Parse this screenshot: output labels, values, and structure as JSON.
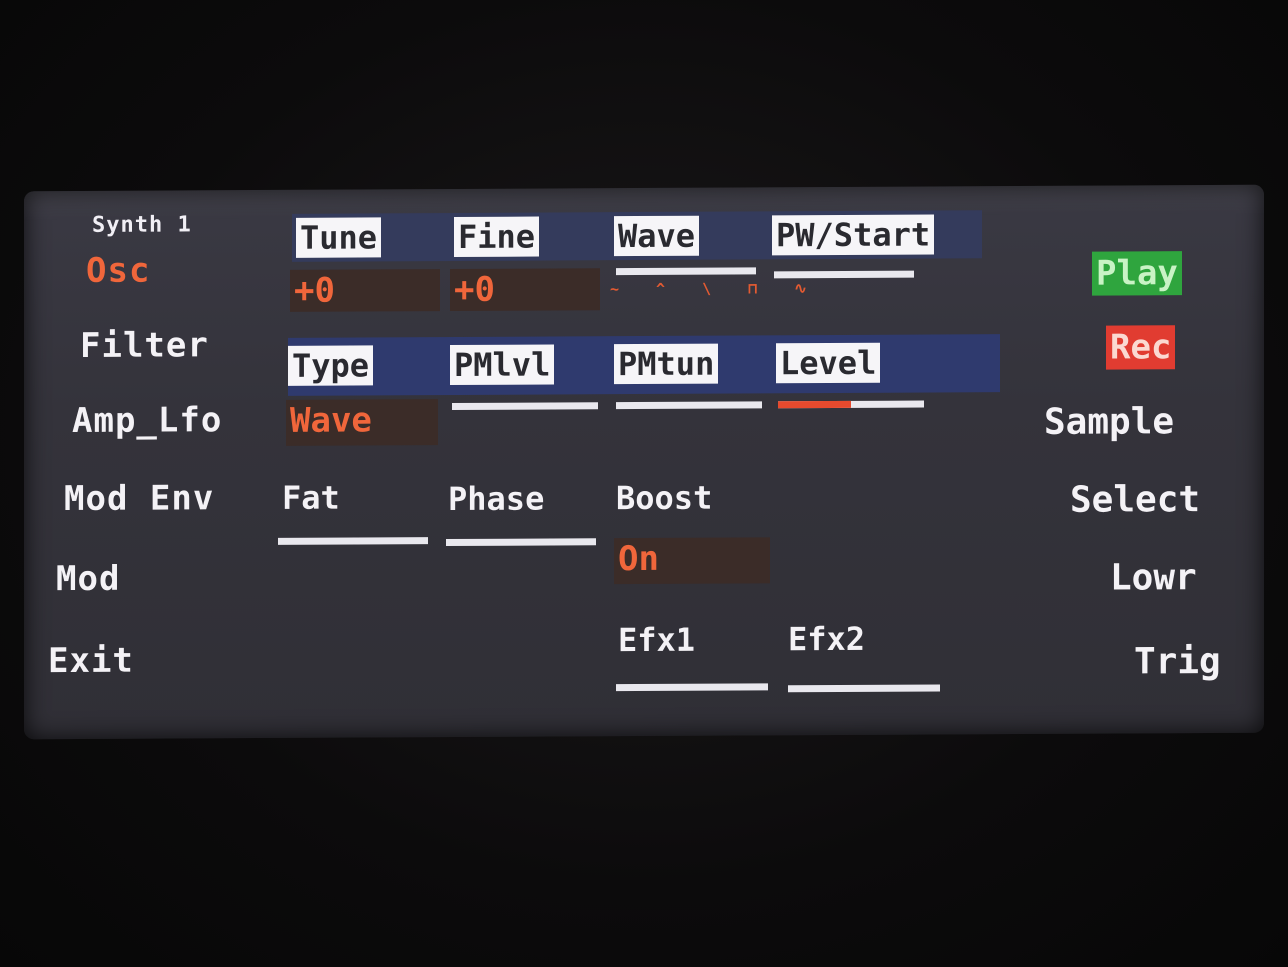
{
  "screen": {
    "title": "Synth 1"
  },
  "menu": {
    "items": [
      {
        "label": "Osc",
        "active": true
      },
      {
        "label": "Filter"
      },
      {
        "label": "Amp_Lfo"
      },
      {
        "label": "Mod Env"
      },
      {
        "label": "Mod"
      },
      {
        "label": "Exit"
      }
    ]
  },
  "row1": {
    "tune": {
      "label": "Tune",
      "value": "+0"
    },
    "fine": {
      "label": "Fine",
      "value": "+0"
    },
    "wave": {
      "label": "Wave",
      "icons": "~ ^ \\ ⊓ ∿"
    },
    "pw_start": {
      "label": "PW/Start"
    }
  },
  "row2": {
    "type": {
      "label": "Type",
      "value": "Wave"
    },
    "pm_lvl": {
      "label": "PMlvl"
    },
    "pm_tun": {
      "label": "PMtun"
    },
    "level": {
      "label": "Level",
      "fill": 0.5
    }
  },
  "row3": {
    "fat": {
      "label": "Fat"
    },
    "phase": {
      "label": "Phase"
    },
    "boost": {
      "label": "Boost",
      "value": "On"
    }
  },
  "row4": {
    "efx1": {
      "label": "Efx1"
    },
    "efx2": {
      "label": "Efx2"
    }
  },
  "right": {
    "play": "Play",
    "rec": "Rec",
    "sample": "Sample",
    "select": "Select",
    "lowr": "Lowr",
    "trig": "Trig"
  },
  "colors": {
    "accent": "#f0663b",
    "play": "#2fa53e",
    "rec": "#e13c31",
    "band": "#2f3a6e"
  }
}
